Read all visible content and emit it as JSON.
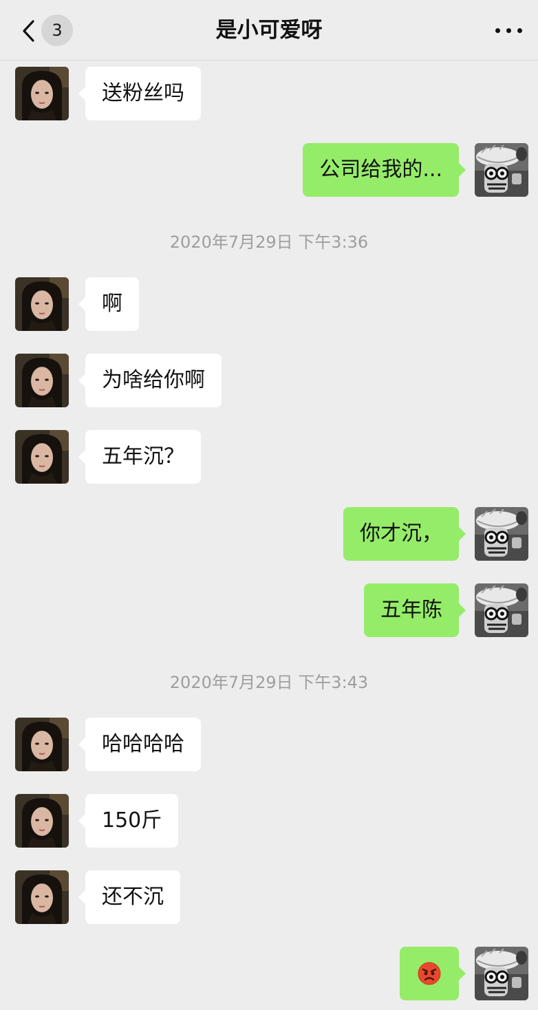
{
  "header": {
    "title": "是小可爱呀",
    "unread_count": "3"
  },
  "timestamps": [
    "2020年7月29日 下午3:36",
    "2020年7月29日 下午3:43"
  ],
  "messages": [
    {
      "side": "received",
      "text": "送粉丝吗"
    },
    {
      "side": "sent",
      "text": "公司给我的..."
    },
    {
      "side": "received",
      "text": "啊"
    },
    {
      "side": "received",
      "text": "为啥给你啊"
    },
    {
      "side": "received",
      "text": "五年沉？"
    },
    {
      "side": "sent",
      "text": "你才沉，"
    },
    {
      "side": "sent",
      "text": "五年陈"
    },
    {
      "side": "received",
      "text": "哈哈哈哈"
    },
    {
      "side": "received",
      "text": "150斤"
    },
    {
      "side": "received",
      "text": "还不沉"
    },
    {
      "side": "sent",
      "emoji": "angry-face-icon"
    }
  ],
  "colors": {
    "background": "#ededed",
    "sent_bubble": "#95ec69",
    "received_bubble": "#ffffff",
    "timestamp_text": "#9e9e9e",
    "emoji": "#e8492e"
  }
}
